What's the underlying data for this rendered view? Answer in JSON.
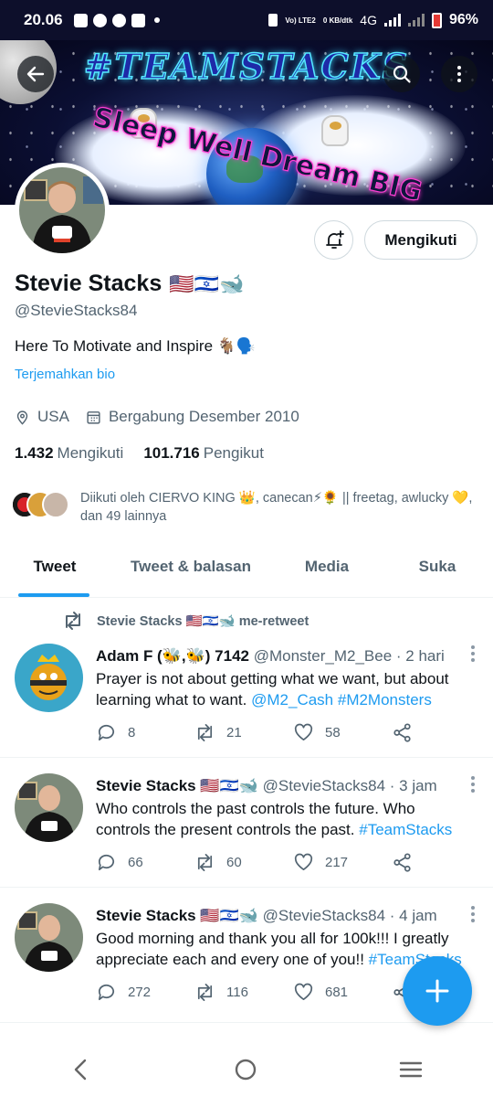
{
  "status_bar": {
    "time": "20.06",
    "network_volte": "Vo) LTE2",
    "speed": "0 KB/dtk",
    "network": "4G",
    "battery": "96%"
  },
  "banner": {
    "headline": "#TEAMSTACKS",
    "tagline": "Sleep Well Dream BIG"
  },
  "profile": {
    "name": "Stevie Stacks",
    "name_emojis": "🇺🇸🇮🇱🐋",
    "handle": "@StevieStacks84",
    "bio": "Here To Motivate and Inspire 🐐🗣️",
    "translate_label": "Terjemahkan bio",
    "location": "USA",
    "joined": "Bergabung Desember 2010",
    "following_count": "1.432",
    "following_label": "Mengikuti",
    "followers_count": "101.716",
    "followers_label": "Pengikut",
    "follow_button": "Mengikuti",
    "followed_by": "Diikuti oleh CIERVO KING 👑, canecan⚡🌻 || freetag, awlucky 💛, dan 49 lainnya"
  },
  "tabs": [
    "Tweet",
    "Tweet & balasan",
    "Media",
    "Suka"
  ],
  "tweets": [
    {
      "retweet_by": "Stevie Stacks 🇺🇸🇮🇱🐋 me-retweet",
      "author": "Adam F (🐝,🐝) 7142",
      "handle": "@Monster_M2_Bee",
      "time": "· 2 hari",
      "line1": "Prayer is not about getting what we want, but about",
      "line2_text": "learning what to want.",
      "line2_links": "@M2_Cash #M2Monsters",
      "replies": "8",
      "retweets": "21",
      "likes": "58"
    },
    {
      "author": "Stevie Stacks 🇺🇸🇮🇱🐋",
      "handle": "@StevieStacks84",
      "time": "· 3 jam",
      "line1": "Who controls the past controls the future. Who",
      "line2_text": "controls the present controls the past.",
      "line2_links": "#TeamStacks",
      "replies": "66",
      "retweets": "60",
      "likes": "217"
    },
    {
      "author": "Stevie Stacks 🇺🇸🇮🇱🐋",
      "handle": "@StevieStacks84",
      "time": "· 4 jam",
      "line1": "Good morning and thank you all for 100k!!! I greatly",
      "line2_text": "appreciate each and every one of you!!",
      "line2_links": "#TeamStacks",
      "replies": "272",
      "retweets": "116",
      "likes": "681"
    }
  ],
  "colors": {
    "accent": "#1d9bf0",
    "text": "#0f1419",
    "muted": "#536471"
  }
}
